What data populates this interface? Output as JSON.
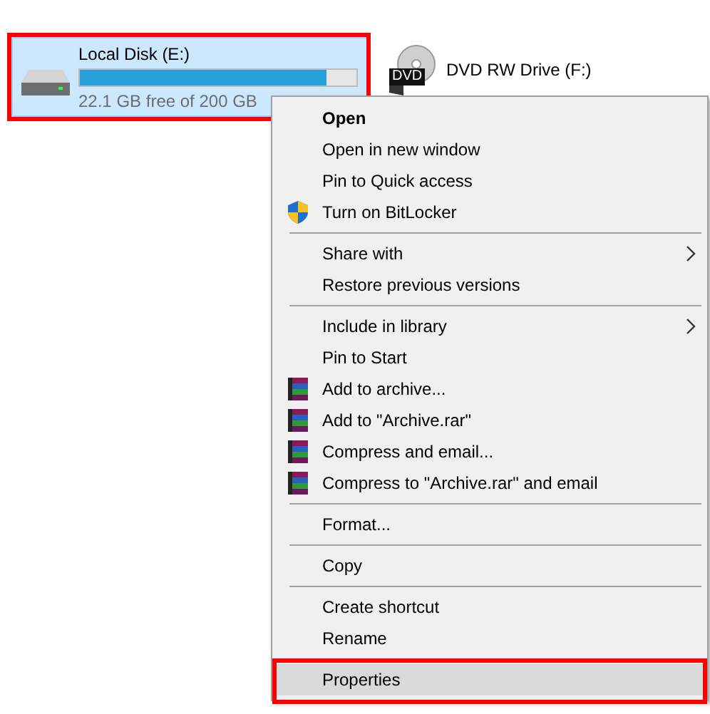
{
  "drives": [
    {
      "name": "Local Disk (E:)",
      "kind": "disk",
      "selected": true,
      "level": 0.89,
      "free": "22.1 GB free of 200 GB"
    },
    {
      "name": "DVD RW Drive (F:)",
      "kind": "dvd",
      "selected": false,
      "badge": "DVD"
    }
  ],
  "context_menu": {
    "items": [
      {
        "kind": "item",
        "label": "Open",
        "bold": true,
        "selected": false
      },
      {
        "kind": "item",
        "label": "Open in new window",
        "selected": false
      },
      {
        "kind": "item",
        "label": "Pin to Quick access",
        "selected": false
      },
      {
        "kind": "shield",
        "label": "Turn on BitLocker",
        "selected": false
      },
      {
        "kind": "separator"
      },
      {
        "kind": "item",
        "label": "Share with",
        "submenu": true,
        "selected": false
      },
      {
        "kind": "item",
        "label": "Restore previous versions",
        "selected": false
      },
      {
        "kind": "separator"
      },
      {
        "kind": "item",
        "label": "Include in library",
        "submenu": true,
        "selected": false
      },
      {
        "kind": "item",
        "label": "Pin to Start",
        "selected": false
      },
      {
        "kind": "archive",
        "label": "Add to archive...",
        "selected": false
      },
      {
        "kind": "archive",
        "label": "Add to \"Archive.rar\"",
        "selected": false
      },
      {
        "kind": "archive",
        "label": "Compress and email...",
        "selected": false
      },
      {
        "kind": "archive",
        "label": "Compress to \"Archive.rar\" and email",
        "selected": false
      },
      {
        "kind": "separator"
      },
      {
        "kind": "item",
        "label": "Format...",
        "selected": false
      },
      {
        "kind": "separator"
      },
      {
        "kind": "item",
        "label": "Copy",
        "selected": false
      },
      {
        "kind": "separator"
      },
      {
        "kind": "item",
        "label": "Create shortcut",
        "selected": false
      },
      {
        "kind": "item",
        "label": "Rename",
        "selected": false
      },
      {
        "kind": "separator"
      },
      {
        "kind": "item",
        "label": "Properties",
        "selected": true
      }
    ]
  }
}
